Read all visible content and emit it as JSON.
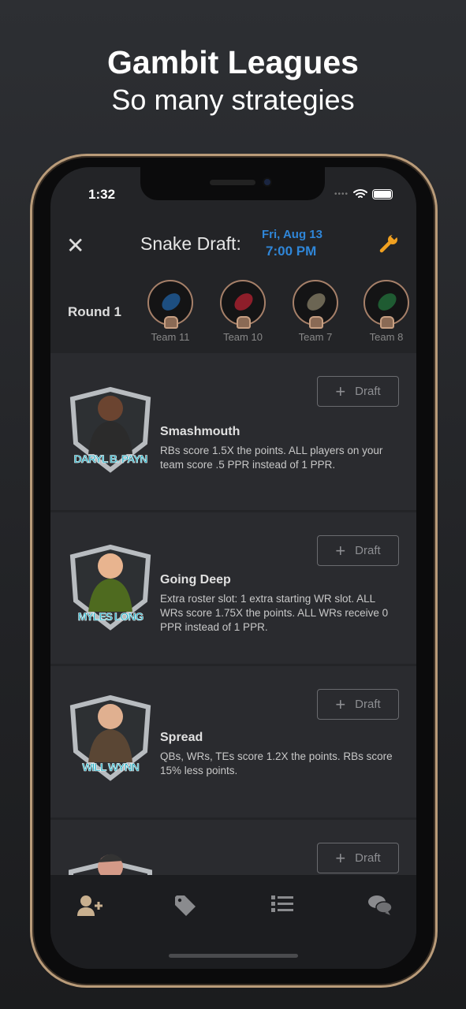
{
  "promo": {
    "title": "Gambit Leagues",
    "subtitle": "So many strategies"
  },
  "status_bar": {
    "time": "1:32"
  },
  "header": {
    "title": "Snake Draft:",
    "date": "Fri, Aug 13",
    "time": "7:00 PM",
    "accent": "#2f86d8"
  },
  "round": {
    "label": "Round 1",
    "teams": [
      {
        "name": "Team 11",
        "color": "#1d4e80"
      },
      {
        "name": "Team 10",
        "color": "#8e1e2a"
      },
      {
        "name": "Team 7",
        "color": "#6b6553"
      },
      {
        "name": "Team 8",
        "color": "#1f5b32"
      }
    ]
  },
  "strategies": [
    {
      "coach": "DARYL B. PAYN",
      "name": "Smashmouth",
      "description": "RBs score 1.5X the points. ALL players on your team score .5 PPR instead of 1 PPR.",
      "button": "Draft"
    },
    {
      "coach": "MYLES LONG",
      "name": "Going Deep",
      "description": "Extra roster slot: 1 extra starting WR slot. ALL WRs score 1.75X the points. ALL WRs receive 0 PPR instead of 1 PPR.",
      "button": "Draft"
    },
    {
      "coach": "WILL WYNN",
      "name": "Spread",
      "description": "QBs, WRs, TEs score 1.2X the points. RBs score 15% less points.",
      "button": "Draft"
    },
    {
      "button": "Draft"
    }
  ],
  "tabbar": {
    "items": [
      "add-user-icon",
      "tag-icon",
      "list-icon",
      "chat-icon"
    ],
    "active_color": "#c9b08f"
  }
}
